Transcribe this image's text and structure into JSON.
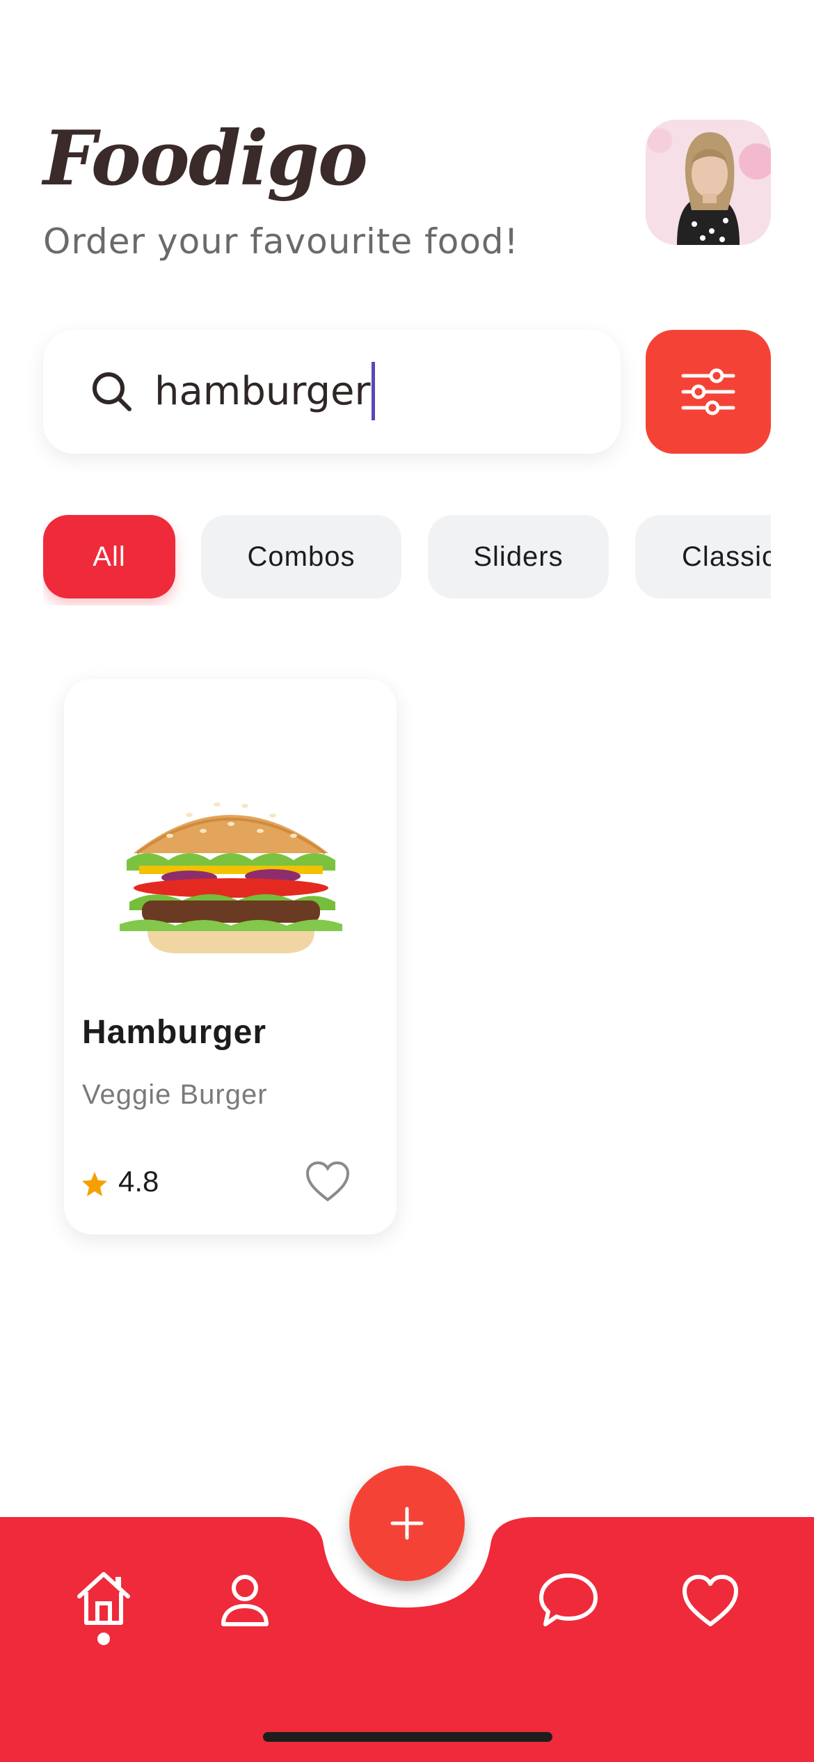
{
  "app": {
    "brand": "Foodigo",
    "tagline": "Order your favourite food!"
  },
  "profile": {
    "avatar_icon": "user-photo"
  },
  "search": {
    "value": "hamburger",
    "icon": "search-icon"
  },
  "filter": {
    "icon": "sliders-icon"
  },
  "categories": [
    {
      "label": "All",
      "active": true
    },
    {
      "label": "Combos",
      "active": false
    },
    {
      "label": "Sliders",
      "active": false
    },
    {
      "label": "Classic",
      "active": false
    }
  ],
  "products": [
    {
      "name": "Hamburger",
      "subtitle": "Veggie Burger",
      "rating": "4.8",
      "favorite": false
    }
  ],
  "bottom_nav": {
    "items": [
      "home-icon",
      "profile-icon",
      "chat-icon",
      "heart-icon"
    ],
    "active": "home-icon",
    "fab_icon": "plus-icon"
  },
  "colors": {
    "accent": "#ef2a3a",
    "filter_button": "#f44336",
    "star": "#f5a000",
    "chip_bg": "#f1f2f4"
  }
}
